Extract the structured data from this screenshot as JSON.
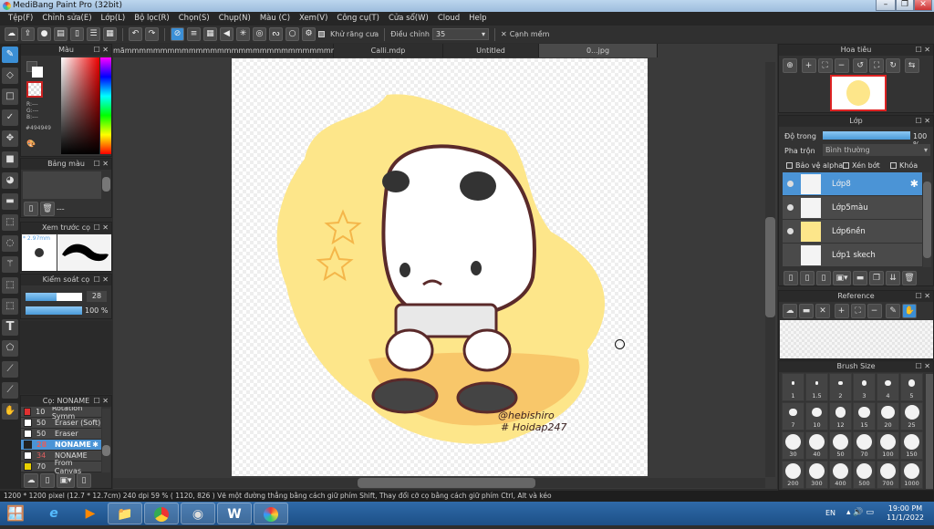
{
  "window": {
    "title": "MediBang Paint Pro (32bit)",
    "minimize": "–",
    "maximize": "❐",
    "close": "✕"
  },
  "menu": [
    "Tệp(F)",
    "Chỉnh sửa(E)",
    "Lớp(L)",
    "Bộ lọc(R)",
    "Chọn(S)",
    "Chụp(N)",
    "Màu (C)",
    "Xem(V)",
    "Công cụ(T)",
    "Cửa sổ(W)",
    "Cloud",
    "Help"
  ],
  "toolbar": {
    "antialias_label": "Khử răng cưa",
    "adjust_label": "Điều chỉnh",
    "adjust_value": "35",
    "soft_edge_label": "Cạnh mềm"
  },
  "color_panel": {
    "title": "Màu",
    "r": "R:---",
    "g": "G:---",
    "b": "B:---",
    "hex": "#494949"
  },
  "palette_panel": {
    "title": "Bảng màu",
    "dash": "---"
  },
  "brush_preview": {
    "title": "Xem trước cọ",
    "size": "* 2.97mm"
  },
  "brush_control": {
    "title": "Kiểm soát cọ",
    "size_value": "28",
    "size_fraction": 0.55,
    "opacity_value": "100 %",
    "opacity_fraction": 1.0
  },
  "brush_list": {
    "title": "Cọ: NONAME",
    "items": [
      {
        "size": "10",
        "name": "Rotation Symm",
        "color": "#e03030"
      },
      {
        "size": "50",
        "name": "Eraser (Soft)",
        "color": "#ffffff"
      },
      {
        "size": "50",
        "name": "Eraser",
        "color": "#ffffff"
      },
      {
        "size": "28",
        "name": "NONAME",
        "color": "#222222",
        "selected": true
      },
      {
        "size": "34",
        "name": "NONAME",
        "color": "#ffffff"
      },
      {
        "size": "70",
        "name": "From Canvas",
        "color": "#e8d000"
      }
    ]
  },
  "tabs": [
    "mãmmmmmmmmmmmmmmmmmmmmmmmmmmmmmmmmmmmmm.mdp",
    "Calli.mdp",
    "Untitled",
    "0...jpg"
  ],
  "artwork": {
    "signature_line1": "@hebishiro",
    "signature_line2": "# Hoidap247"
  },
  "navigator": {
    "title": "Hoa tiêu"
  },
  "layer_panel": {
    "title": "Lớp",
    "opacity_label": "Độ trong",
    "opacity_value": "100 %",
    "opacity_fraction": 1.0,
    "blend_label": "Pha trộn",
    "blend_value": "Bình thường",
    "protect_alpha": "Bảo vệ alpha",
    "clipping": "Xén bớt",
    "lock": "Khóa",
    "layers": [
      {
        "name": "Lớp8",
        "selected": true
      },
      {
        "name": "Lớp5màu"
      },
      {
        "name": "Lớp6nền"
      },
      {
        "name": "Lớp1 skech"
      }
    ]
  },
  "reference": {
    "title": "Reference"
  },
  "brush_size": {
    "title": "Brush Size",
    "sizes": [
      "1",
      "1.5",
      "2",
      "3",
      "4",
      "5",
      "7",
      "10",
      "12",
      "15",
      "20",
      "25",
      "30",
      "40",
      "50",
      "70",
      "100",
      "150",
      "200",
      "300",
      "400",
      "500",
      "700",
      "1000"
    ]
  },
  "status": {
    "text": "1200 * 1200 pixel   (12.7 * 12.7cm)   240 dpi   59 %   ( 1120, 826 )   Vẽ một đường thẳng bằng cách giữ phím Shift, Thay đổi cỡ cọ bằng cách giữ phím Ctrl, Alt và kéo"
  },
  "taskbar": {
    "lang": "EN",
    "time": "19:00 PM",
    "date": "11/1/2022"
  },
  "colors": {
    "accent": "#3b8fd6",
    "panel": "#333333",
    "yellow": "#fde68a"
  }
}
